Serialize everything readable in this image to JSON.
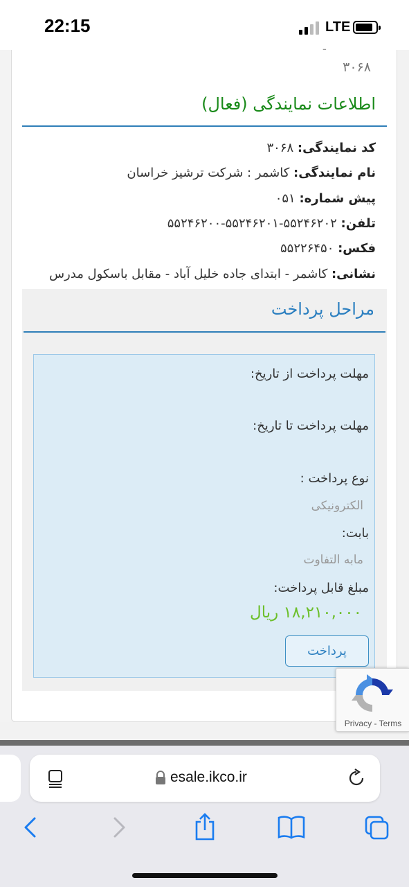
{
  "status_bar": {
    "time": "22:15",
    "network": "LTE"
  },
  "agency": {
    "partial_top": "ـ",
    "previous_code": "۳۰۶۸",
    "title": "اطلاعات نمایندگی (فعال)",
    "rows": [
      {
        "label": "کد نمایندگی:",
        "value": " ۳۰۶۸"
      },
      {
        "label": "نام نمایندگی:",
        "value": " کاشمر : شرکت ترشیز خراسان"
      },
      {
        "label": "پیش شماره:",
        "value": " ۰۵۱"
      },
      {
        "label": "تلفن:",
        "value": " ۵۵۲۴۶۲۰۲-۵۵۲۴۶۲۰۱-۵۵۲۴۶۲۰۰"
      },
      {
        "label": "فکس:",
        "value": " ۵۵۲۲۶۴۵۰"
      },
      {
        "label": "نشانی:",
        "value": " کاشمر - ابتدای جاده خلیل آباد - مقابل باسکول مدرس"
      }
    ]
  },
  "payment": {
    "section_title": "مراحل پرداخت",
    "from_date_label": "مهلت پرداخت از تاریخ:",
    "to_date_label": "مهلت پرداخت تا تاریخ:",
    "type_label": "نوع پرداخت :",
    "type_value": "الکترونیکی",
    "for_label": "بابت:",
    "for_value": "مابه التفاوت",
    "amount_label": "مبلغ قابل پرداخت:",
    "amount_value": "۱۸,۲۱۰,۰۰۰ ریال",
    "pay_button": "پرداخت"
  },
  "recaptcha": {
    "privacy": "Privacy",
    "separator": " - ",
    "terms": "Terms"
  },
  "browser": {
    "url": "esale.ikco.ir",
    "icons": [
      "reader-icon",
      "lock-icon",
      "reload-icon",
      "back-icon",
      "forward-icon",
      "share-icon",
      "bookmarks-icon",
      "tabs-icon"
    ]
  }
}
